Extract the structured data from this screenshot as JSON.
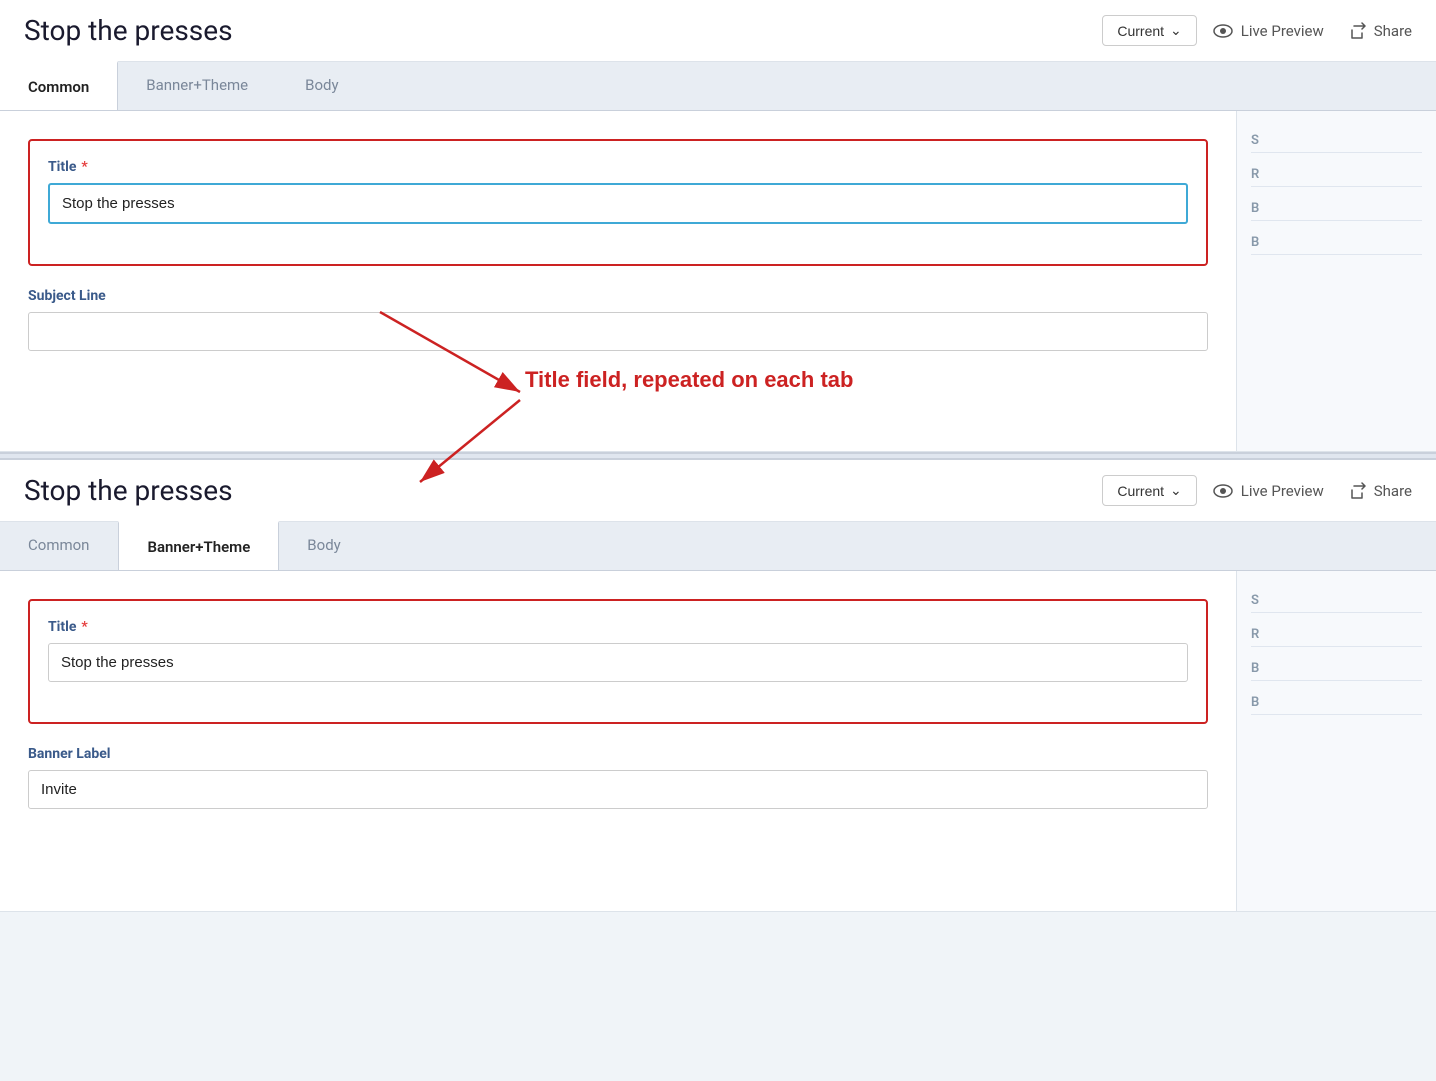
{
  "panels": [
    {
      "id": "panel-top",
      "header": {
        "title": "Stop the presses",
        "current_label": "Current",
        "live_preview_label": "Live Preview",
        "share_label": "Share"
      },
      "tabs": [
        {
          "id": "common",
          "label": "Common",
          "active": true
        },
        {
          "id": "banner-theme",
          "label": "Banner+Theme",
          "active": false
        },
        {
          "id": "body",
          "label": "Body",
          "active": false
        }
      ],
      "fields": [
        {
          "id": "title",
          "label": "Title",
          "required": true,
          "value": "Stop the presses",
          "focused": true
        },
        {
          "id": "subject-line",
          "label": "Subject Line",
          "required": false,
          "value": "",
          "focused": false
        }
      ],
      "side_items": [
        "S",
        "R",
        "B",
        "B"
      ]
    },
    {
      "id": "panel-bottom",
      "header": {
        "title": "Stop the presses",
        "current_label": "Current",
        "live_preview_label": "Live Preview",
        "share_label": "Share"
      },
      "tabs": [
        {
          "id": "common",
          "label": "Common",
          "active": false
        },
        {
          "id": "banner-theme",
          "label": "Banner+Theme",
          "active": true
        },
        {
          "id": "body",
          "label": "Body",
          "active": false
        }
      ],
      "fields": [
        {
          "id": "title",
          "label": "Title",
          "required": true,
          "value": "Stop the presses",
          "focused": false
        },
        {
          "id": "banner-label",
          "label": "Banner Label",
          "required": false,
          "value": "Invite",
          "focused": false
        }
      ],
      "side_items": [
        "S",
        "R",
        "B",
        "B"
      ]
    }
  ],
  "annotation": {
    "text": "Title field, repeated on each tab"
  }
}
